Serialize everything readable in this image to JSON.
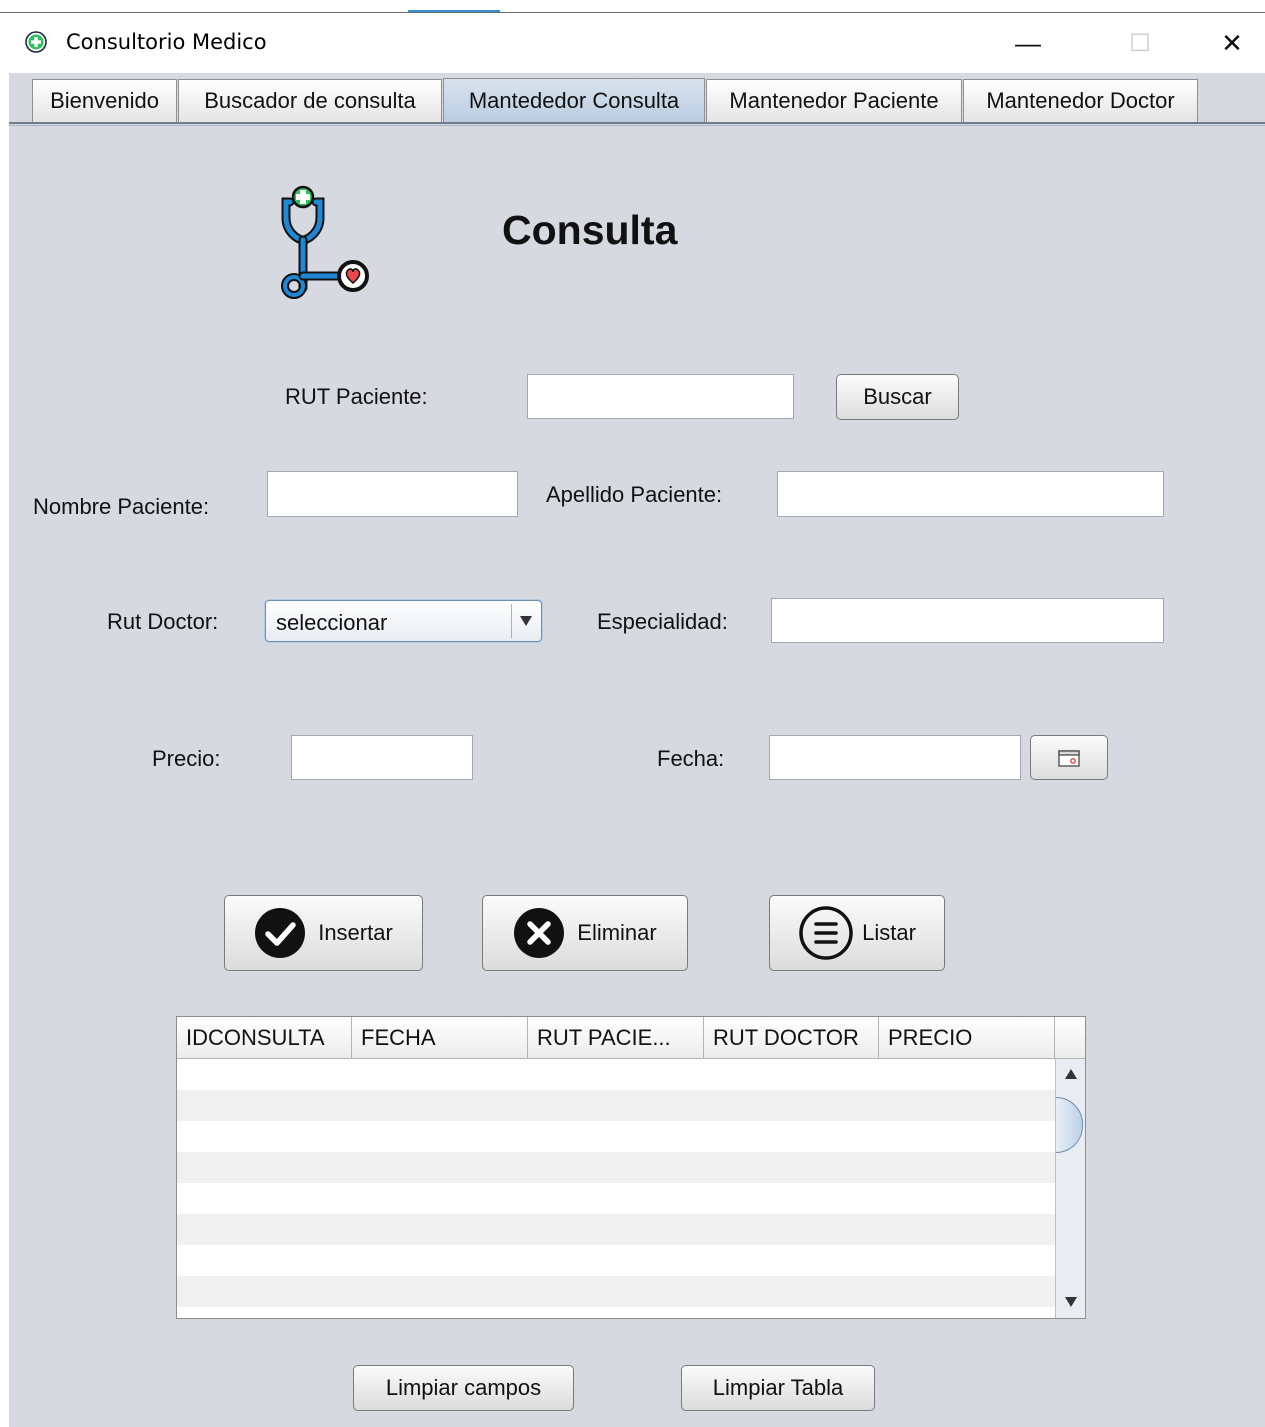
{
  "window": {
    "title": "Consultorio Medico",
    "minimize_glyph": "—",
    "maximize_glyph": "☐",
    "close_glyph": "✕"
  },
  "tabs": [
    {
      "label": "Bienvenido"
    },
    {
      "label": "Buscador de consulta"
    },
    {
      "label": "Mantededor Consulta"
    },
    {
      "label": "Mantenedor Paciente"
    },
    {
      "label": "Mantenedor Doctor"
    }
  ],
  "form": {
    "heading": "Consulta",
    "rut_paciente_label": "RUT Paciente:",
    "rut_paciente_value": "",
    "buscar_button": "Buscar",
    "nombre_label": "Nombre Paciente:",
    "nombre_value": "",
    "apellido_label": "Apellido Paciente:",
    "apellido_value": "",
    "rut_doctor_label": "Rut Doctor:",
    "rut_doctor_selected": "seleccionar",
    "especialidad_label": "Especialidad:",
    "especialidad_value": "",
    "precio_label": "Precio:",
    "precio_value": "",
    "fecha_label": "Fecha:",
    "fecha_value": ""
  },
  "actions": {
    "insertar": "Insertar",
    "eliminar": "Eliminar",
    "listar": "Listar"
  },
  "table": {
    "columns": [
      "IDCONSULTA",
      "FECHA",
      "RUT PACIE...",
      "RUT DOCTOR",
      "PRECIO"
    ],
    "rows": []
  },
  "footer": {
    "limpiar_campos": "Limpiar campos",
    "limpiar_tabla": "Limpiar Tabla"
  },
  "icons": {
    "app": "medical-cross-icon",
    "header": "stethoscope-icon",
    "calendar": "calendar-icon",
    "insertar": "check-circle-icon",
    "eliminar": "x-circle-icon",
    "listar": "list-circle-icon"
  },
  "colors": {
    "background": "#d6d9df",
    "active_tab": "#c6d6e6",
    "stethoscope_blue": "#1f88d6",
    "accent_green": "#2ec25a",
    "heart_red": "#e8484d"
  }
}
